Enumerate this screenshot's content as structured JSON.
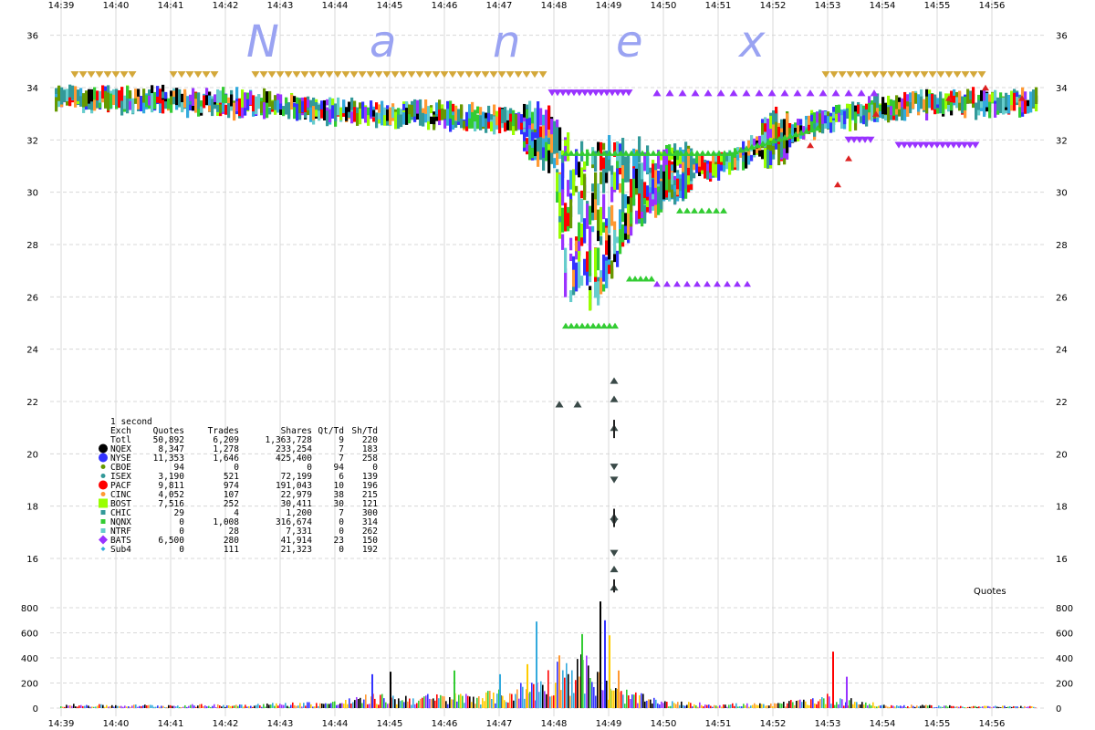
{
  "chart_data": [
    {
      "type": "scatter",
      "title": "",
      "watermark": [
        "N",
        "a",
        "n",
        "e",
        "x"
      ],
      "xlabel": "",
      "ylabel": "",
      "x_ticks": [
        "14:39",
        "14:40",
        "14:41",
        "14:42",
        "14:43",
        "14:44",
        "14:45",
        "14:46",
        "14:47",
        "14:48",
        "14:49",
        "14:50",
        "14:51",
        "14:52",
        "14:53",
        "14:54",
        "14:55",
        "14:56"
      ],
      "y_ticks": [
        16,
        18,
        20,
        22,
        24,
        26,
        28,
        30,
        32,
        34,
        36
      ],
      "ylim": [
        14.5,
        37
      ],
      "grid": true,
      "series": [
        {
          "name": "NQEX",
          "color": "#000000",
          "marker": "circle"
        },
        {
          "name": "NYSE",
          "color": "#3333ff",
          "marker": "circle"
        },
        {
          "name": "CBOE",
          "color": "#669900",
          "marker": "circle"
        },
        {
          "name": "ISEX",
          "color": "#339999",
          "marker": "circle"
        },
        {
          "name": "PACF",
          "color": "#ff0000",
          "marker": "circle"
        },
        {
          "name": "CINC",
          "color": "#ff9933",
          "marker": "circle"
        },
        {
          "name": "BOST",
          "color": "#99ff00",
          "marker": "square"
        },
        {
          "name": "CHIC",
          "color": "#339999",
          "marker": "square"
        },
        {
          "name": "NQNX",
          "color": "#33cc33",
          "marker": "square"
        },
        {
          "name": "NTRF",
          "color": "#66cccc",
          "marker": "square"
        },
        {
          "name": "BATS",
          "color": "#9933ff",
          "marker": "diamond"
        },
        {
          "name": "Sub4",
          "color": "#33aadd",
          "marker": "diamond"
        }
      ],
      "price_path": [
        {
          "t": "14:39",
          "y": 33.6
        },
        {
          "t": "14:40",
          "y": 33.5
        },
        {
          "t": "14:41",
          "y": 33.5
        },
        {
          "t": "14:42",
          "y": 33.4
        },
        {
          "t": "14:43",
          "y": 33.3
        },
        {
          "t": "14:44",
          "y": 33.1
        },
        {
          "t": "14:45",
          "y": 33.0
        },
        {
          "t": "14:46",
          "y": 32.9
        },
        {
          "t": "14:47",
          "y": 32.8
        },
        {
          "t": "14:47:30",
          "y": 32.5
        },
        {
          "t": "14:48",
          "y": 31.8
        },
        {
          "t": "14:48:15",
          "y": 28.5
        },
        {
          "t": "14:48:30",
          "y": 27.0
        },
        {
          "t": "14:48:45",
          "y": 27.5
        },
        {
          "t": "14:49",
          "y": 29.5
        },
        {
          "t": "14:49:30",
          "y": 30.3
        },
        {
          "t": "14:50",
          "y": 30.8
        },
        {
          "t": "14:51",
          "y": 31.0
        },
        {
          "t": "14:52",
          "y": 32.0
        },
        {
          "t": "14:53",
          "y": 32.8
        },
        {
          "t": "14:54",
          "y": 33.2
        },
        {
          "t": "14:55",
          "y": 33.4
        },
        {
          "t": "14:56",
          "y": 33.4
        },
        {
          "t": "14:57",
          "y": 33.4
        }
      ],
      "band_top": [
        {
          "t": "14:39",
          "y": 34.0
        },
        {
          "t": "14:47",
          "y": 33.3
        },
        {
          "t": "14:48",
          "y": 32.8
        },
        {
          "t": "14:48:20",
          "y": 31.6
        },
        {
          "t": "14:49",
          "y": 31.8
        },
        {
          "t": "14:50",
          "y": 31.5
        },
        {
          "t": "14:51",
          "y": 31.6
        },
        {
          "t": "14:52",
          "y": 32.8
        },
        {
          "t": "14:53",
          "y": 33.4
        },
        {
          "t": "14:54",
          "y": 33.8
        },
        {
          "t": "14:57",
          "y": 33.8
        }
      ],
      "band_bottom": [
        {
          "t": "14:39",
          "y": 33.0
        },
        {
          "t": "14:47",
          "y": 32.2
        },
        {
          "t": "14:48",
          "y": 31.0
        },
        {
          "t": "14:48:10",
          "y": 26.0
        },
        {
          "t": "14:48:40",
          "y": 25.8
        },
        {
          "t": "14:49",
          "y": 26.5
        },
        {
          "t": "14:49:20",
          "y": 28.5
        },
        {
          "t": "14:50",
          "y": 29.8
        },
        {
          "t": "14:51",
          "y": 30.5
        },
        {
          "t": "14:52",
          "y": 31.3
        },
        {
          "t": "14:53",
          "y": 32.3
        },
        {
          "t": "14:54",
          "y": 32.8
        },
        {
          "t": "14:57",
          "y": 33.0
        }
      ],
      "outliers": [
        {
          "t": "14:49",
          "y": 22.8
        },
        {
          "t": "14:49",
          "y": 22.1
        },
        {
          "t": "14:49",
          "y": 21.0
        },
        {
          "t": "14:49",
          "y": 19.5
        },
        {
          "t": "14:49",
          "y": 19.0
        },
        {
          "t": "14:49",
          "y": 17.6
        },
        {
          "t": "14:49",
          "y": 17.4
        },
        {
          "t": "14:49",
          "y": 16.2
        },
        {
          "t": "14:49",
          "y": 15.6
        },
        {
          "t": "14:49",
          "y": 14.9
        },
        {
          "t": "14:48",
          "y": 21.9
        },
        {
          "t": "14:48:20",
          "y": 21.9
        }
      ],
      "annotation_table": {
        "interval": "1 second",
        "headers": [
          "Exch",
          "Quotes",
          "Trades",
          "Shares",
          "Qt/Td",
          "Sh/Td"
        ],
        "rows": [
          {
            "exch": "Totl",
            "quotes": "50,892",
            "trades": "6,209",
            "shares": "1,363,728",
            "qttd": "9",
            "shtd": "220"
          },
          {
            "exch": "NQEX",
            "quotes": "8,347",
            "trades": "1,278",
            "shares": "233,254",
            "qttd": "7",
            "shtd": "183"
          },
          {
            "exch": "NYSE",
            "quotes": "11,353",
            "trades": "1,646",
            "shares": "425,400",
            "qttd": "7",
            "shtd": "258"
          },
          {
            "exch": "CBOE",
            "quotes": "94",
            "trades": "0",
            "shares": "0",
            "qttd": "94",
            "shtd": "0"
          },
          {
            "exch": "ISEX",
            "quotes": "3,190",
            "trades": "521",
            "shares": "72,199",
            "qttd": "6",
            "shtd": "139"
          },
          {
            "exch": "PACF",
            "quotes": "9,811",
            "trades": "974",
            "shares": "191,043",
            "qttd": "10",
            "shtd": "196"
          },
          {
            "exch": "CINC",
            "quotes": "4,052",
            "trades": "107",
            "shares": "22,979",
            "qttd": "38",
            "shtd": "215"
          },
          {
            "exch": "BOST",
            "quotes": "7,516",
            "trades": "252",
            "shares": "30,411",
            "qttd": "30",
            "shtd": "121"
          },
          {
            "exch": "CHIC",
            "quotes": "29",
            "trades": "4",
            "shares": "1,200",
            "qttd": "7",
            "shtd": "300"
          },
          {
            "exch": "NQNX",
            "quotes": "0",
            "trades": "1,008",
            "shares": "316,674",
            "qttd": "0",
            "shtd": "314"
          },
          {
            "exch": "NTRF",
            "quotes": "0",
            "trades": "28",
            "shares": "7,331",
            "qttd": "0",
            "shtd": "262"
          },
          {
            "exch": "BATS",
            "quotes": "6,500",
            "trades": "280",
            "shares": "41,914",
            "qttd": "23",
            "shtd": "150"
          },
          {
            "exch": "Sub4",
            "quotes": "0",
            "trades": "111",
            "shares": "21,323",
            "qttd": "0",
            "shtd": "192"
          }
        ]
      }
    },
    {
      "type": "bar",
      "title": "",
      "ylabel": "Quotes",
      "y_ticks": [
        0,
        200,
        400,
        600,
        800
      ],
      "ylim": [
        0,
        880
      ],
      "grid": true,
      "volume_profile": [
        {
          "t": "14:39",
          "v": 35
        },
        {
          "t": "14:40",
          "v": 30
        },
        {
          "t": "14:41",
          "v": 30
        },
        {
          "t": "14:42",
          "v": 35
        },
        {
          "t": "14:43",
          "v": 45
        },
        {
          "t": "14:44",
          "v": 60
        },
        {
          "t": "14:44:40",
          "v": 120
        },
        {
          "t": "14:45",
          "v": 110
        },
        {
          "t": "14:46",
          "v": 120
        },
        {
          "t": "14:47",
          "v": 150
        },
        {
          "t": "14:47:40",
          "v": 260
        },
        {
          "t": "14:48",
          "v": 380
        },
        {
          "t": "14:48:20",
          "v": 500
        },
        {
          "t": "14:48:40",
          "v": 420
        },
        {
          "t": "14:49",
          "v": 200
        },
        {
          "t": "14:50",
          "v": 60
        },
        {
          "t": "14:51",
          "v": 40
        },
        {
          "t": "14:52",
          "v": 40
        },
        {
          "t": "14:53",
          "v": 120
        },
        {
          "t": "14:54",
          "v": 30
        },
        {
          "t": "14:55",
          "v": 25
        },
        {
          "t": "14:56",
          "v": 20
        },
        {
          "t": "14:57",
          "v": 15
        }
      ],
      "spikes": [
        {
          "t": "14:48:50",
          "v": 850
        },
        {
          "t": "14:48:30",
          "v": 590
        },
        {
          "t": "14:47:40",
          "v": 690
        },
        {
          "t": "14:48:55",
          "v": 700
        },
        {
          "t": "14:49:00",
          "v": 580
        },
        {
          "t": "14:49:10",
          "v": 300
        },
        {
          "t": "14:53:05",
          "v": 450
        },
        {
          "t": "14:53:20",
          "v": 250
        },
        {
          "t": "14:45:00",
          "v": 290
        },
        {
          "t": "14:46:10",
          "v": 300
        },
        {
          "t": "14:47:00",
          "v": 270
        },
        {
          "t": "14:44:40",
          "v": 270
        },
        {
          "t": "14:47:30",
          "v": 350
        },
        {
          "t": "14:48:05",
          "v": 420
        }
      ]
    }
  ]
}
